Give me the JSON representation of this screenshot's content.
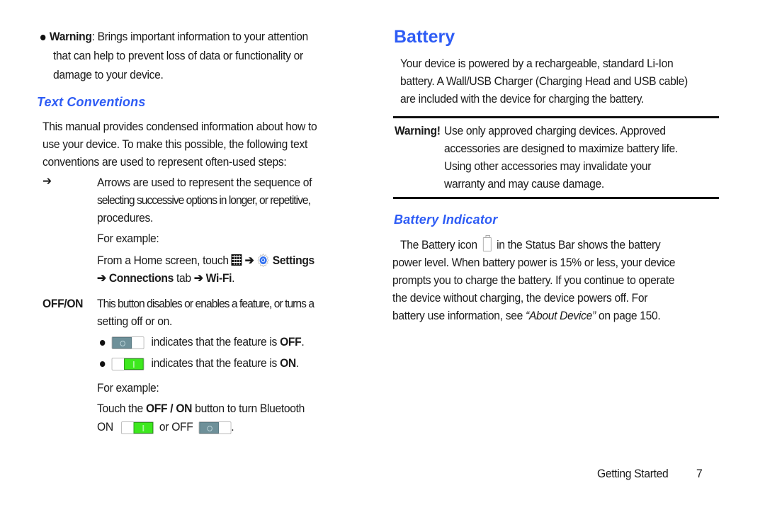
{
  "left": {
    "warning_item": {
      "label": "Warning",
      "line1_rest": ": Brings important information to your attention",
      "line2": "that can help to prevent loss of data or functionality or",
      "line3": "damage to your device."
    },
    "text_conventions": {
      "heading": "Text Conventions",
      "intro_lines": [
        "This manual provides condensed information about how to",
        "use your device. To make this possible, the following text",
        "conventions are used to represent often-used steps:"
      ],
      "arrow_symbol": "➔",
      "arrow_desc_lines": [
        "Arrows are used to represent the sequence of",
        "selecting successive options in longer, or repetitive,",
        "procedures."
      ],
      "for_example_1": "For example:",
      "example_path": {
        "prefix": "From a Home screen, touch",
        "apps_icon": "apps-grid-icon",
        "arrow": "➔",
        "settings_icon": "settings-gear-icon",
        "settings": "Settings",
        "connections": "Connections",
        "tab": "tab",
        "wifi": "Wi-Fi",
        "period": "."
      },
      "offon": {
        "term": "OFF/ON",
        "desc_lines": [
          "This button disables or enables a feature, or turns a",
          "setting off or on."
        ],
        "off_item": {
          "text": "indicates that the feature is",
          "state": "OFF",
          "period": "."
        },
        "on_item": {
          "text": "indicates that the feature is",
          "state": "ON",
          "period": "."
        }
      },
      "for_example_2": "For example:",
      "bluetooth": {
        "prefix": "Touch the",
        "bold": "OFF / ON",
        "suffix": "button to turn Bluetooth",
        "on_label": "ON",
        "or_off_label": "or OFF",
        "period": "."
      }
    }
  },
  "right": {
    "battery": {
      "heading": "Battery",
      "body_lines": [
        "Your device is powered by a rechargeable, standard Li-Ion",
        "battery. A Wall/USB Charger (Charging Head and USB cable)",
        "are included with the device for charging the battery."
      ]
    },
    "warning_box": {
      "label": "Warning!",
      "lines": [
        "Use only approved charging devices. Approved",
        "accessories are designed to maximize battery life.",
        "Using other accessories may invalidate your",
        "warranty and may cause damage."
      ]
    },
    "battery_indicator": {
      "heading": "Battery Indicator",
      "line1_prefix": "The Battery icon",
      "battery_icon": "battery-icon",
      "line1_suffix": "in the Status Bar shows the battery",
      "lines": [
        "power level. When battery power is 15% or less, your device",
        "prompts you to charge the battery. If you continue to operate",
        "the device without charging, the device powers off. For"
      ],
      "last_prefix": "battery use information, see ",
      "last_link": "“About Device”",
      "last_suffix": " on page 150."
    }
  },
  "footer": {
    "section": "Getting Started",
    "page": "7"
  },
  "colors": {
    "heading_blue": "#2e5cf5",
    "toggle_on": "#3de81e",
    "toggle_off": "#6e9099"
  }
}
